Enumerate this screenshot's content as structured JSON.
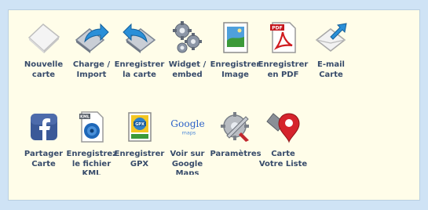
{
  "toolbar": {
    "row1": [
      {
        "label": "Nouvelle\ncarte",
        "icon": "blank-map-icon"
      },
      {
        "label": "Charge /\nImport",
        "icon": "import-arrow-icon"
      },
      {
        "label": "Enregistrer\nla carte",
        "icon": "save-map-icon"
      },
      {
        "label": "Widget /\nembed",
        "icon": "gears-icon"
      },
      {
        "label": "Enregistrer\nImage",
        "icon": "image-file-icon"
      },
      {
        "label": "Enregistrer\nen PDF",
        "icon": "pdf-file-icon"
      },
      {
        "label": "E-mail\nCarte",
        "icon": "email-map-icon"
      }
    ],
    "row2": [
      {
        "label": "Partager\nCarte",
        "icon": "facebook-icon"
      },
      {
        "label": "Enregistrez\nle fichier\nKML",
        "icon": "kml-file-icon"
      },
      {
        "label": "Enregistrer\nGPX",
        "icon": "gpx-file-icon"
      },
      {
        "label": "Voir sur\nGoogle\nMaps",
        "icon": "google-maps-icon",
        "logo_top": "Google",
        "logo_bottom": "maps"
      },
      {
        "label": "Paramètres",
        "icon": "settings-tools-icon"
      },
      {
        "label": "Carte\nVotre Liste",
        "icon": "map-pin-icon"
      }
    ]
  },
  "colors": {
    "background": "#cfe3f5",
    "panel": "#fffde9",
    "label": "#374b6a"
  }
}
